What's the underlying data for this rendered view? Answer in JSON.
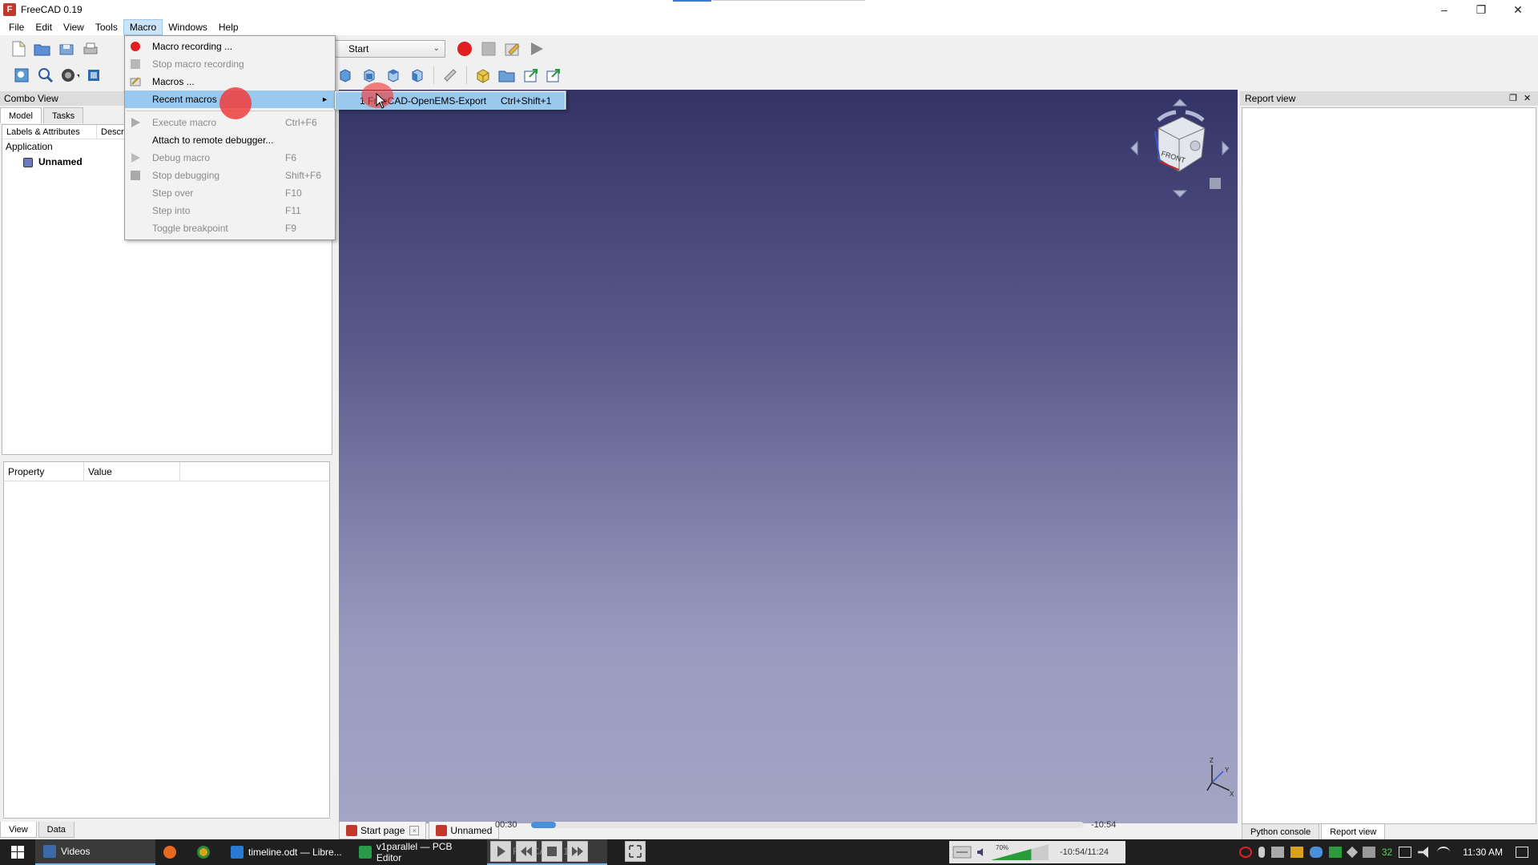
{
  "window": {
    "title": "FreeCAD 0.19",
    "minimize": "–",
    "maximize": "❐",
    "close": "✕"
  },
  "menubar": [
    "File",
    "Edit",
    "View",
    "Tools",
    "Macro",
    "Windows",
    "Help"
  ],
  "toolbar": {
    "workbench": "Start"
  },
  "combo_view": {
    "title": "Combo View",
    "tabs": [
      "Model",
      "Tasks"
    ],
    "tree_columns": [
      "Labels & Attributes",
      "Descri"
    ],
    "tree": {
      "root": "Application",
      "document": "Unnamed"
    },
    "property_columns": [
      "Property",
      "Value"
    ],
    "bottom_tabs": [
      "View",
      "Data"
    ]
  },
  "macro_menu": {
    "items": [
      {
        "label": "Macro recording ...",
        "shortcut": "",
        "disabled": false
      },
      {
        "label": "Stop macro recording",
        "shortcut": "",
        "disabled": true
      },
      {
        "label": "Macros ...",
        "shortcut": "",
        "disabled": false
      },
      {
        "label": "Recent macros",
        "shortcut": "",
        "disabled": false
      },
      {
        "label": "Execute macro",
        "shortcut": "Ctrl+F6",
        "disabled": true
      },
      {
        "label": "Attach to remote debugger...",
        "shortcut": "",
        "disabled": false
      },
      {
        "label": "Debug macro",
        "shortcut": "F6",
        "disabled": true
      },
      {
        "label": "Stop debugging",
        "shortcut": "Shift+F6",
        "disabled": true
      },
      {
        "label": "Step over",
        "shortcut": "F10",
        "disabled": true
      },
      {
        "label": "Step into",
        "shortcut": "F11",
        "disabled": true
      },
      {
        "label": "Toggle breakpoint",
        "shortcut": "F9",
        "disabled": true
      }
    ],
    "recent_submenu": {
      "label": "1 FreeCAD-OpenEMS-Export",
      "shortcut": "Ctrl+Shift+1"
    }
  },
  "doc_tabs": {
    "start": "Start page",
    "doc": "Unnamed"
  },
  "report_view": {
    "title": "Report view",
    "tabs": [
      "Python console",
      "Report view"
    ]
  },
  "player": {
    "elapsed": "00:30",
    "remaining": "-10:54",
    "position": "-10:54/11:24",
    "volume": "70%",
    "progress": 0.045,
    "overlay_label": "FreeCAD 0.19"
  },
  "nav_cube": {
    "face": "FRONT"
  },
  "taskbar": {
    "items": [
      "Videos",
      "timeline.odt — Libre...",
      "v1parallel — PCB Editor"
    ],
    "clock": "11:30 AM",
    "tray_count": "32"
  },
  "colors": {
    "menu_highlight": "#99c9ef",
    "record_red": "#e02020",
    "accent": "#3a7bd5"
  }
}
